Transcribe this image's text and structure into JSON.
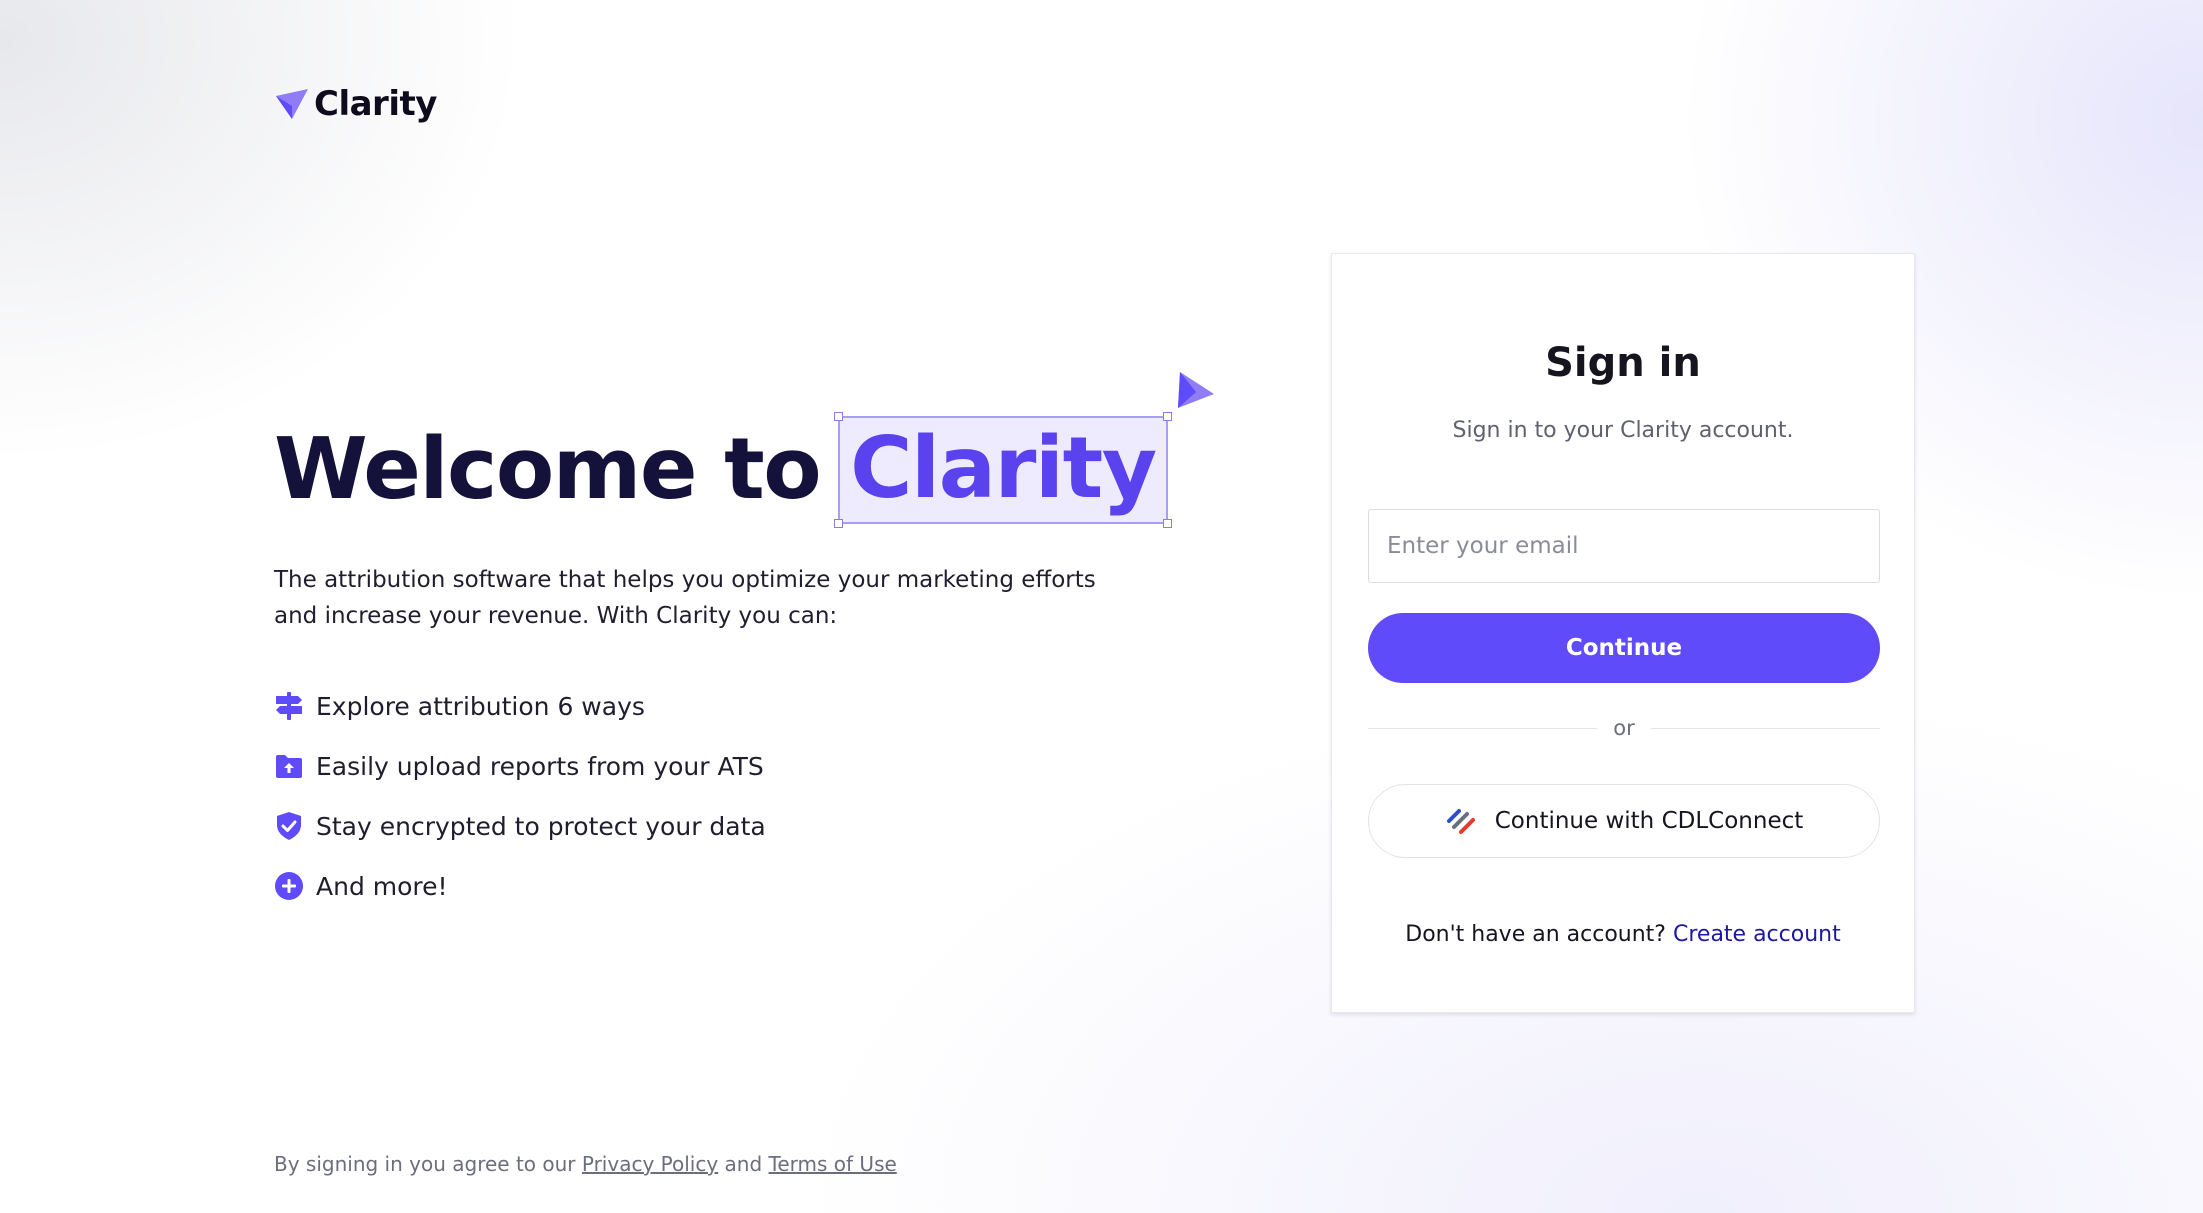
{
  "brand": {
    "name": "Clarity",
    "accent_color": "#5f4bfa",
    "logo_icon": "paper-plane-icon"
  },
  "hero": {
    "title_prefix": "Welcome to",
    "title_brand": "Clarity",
    "subtitle": "The attribution software that helps you optimize your marketing efforts and increase your revenue. With Clarity you can:",
    "features": [
      {
        "icon": "signpost-icon",
        "label": "Explore attribution 6 ways"
      },
      {
        "icon": "folder-upload-icon",
        "label": "Easily upload reports from your ATS"
      },
      {
        "icon": "shield-check-icon",
        "label": "Stay encrypted to protect your data"
      },
      {
        "icon": "plus-circle-icon",
        "label": "And more!"
      }
    ]
  },
  "legal": {
    "prefix": "By signing in you agree to our",
    "privacy_link": "Privacy Policy",
    "conjunction": "and",
    "terms_link": "Terms of Use"
  },
  "signin": {
    "title": "Sign in",
    "subtitle": "Sign in to your Clarity account.",
    "email_placeholder": "Enter your email",
    "email_value": "",
    "continue_label": "Continue",
    "divider_text": "or",
    "sso_label": "Continue with CDLConnect",
    "sso_icon": "cdlconnect-stripes-icon",
    "signup_prompt": "Don't have an account?",
    "signup_link": "Create account"
  }
}
